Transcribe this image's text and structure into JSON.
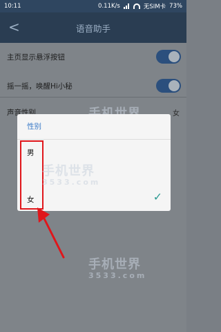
{
  "status_bar": {
    "time": "10:11",
    "speed": "0.11K/s",
    "sim_text": "无SIM卡",
    "battery": "73%"
  },
  "app_bar": {
    "back_label": "<",
    "title": "语音助手"
  },
  "settings": {
    "row1_label": "主页显示悬浮按钮",
    "row2_label": "摇一摇，唤醒Hi小秘",
    "row3_label": "声音性别",
    "row3_value": "女"
  },
  "dialog": {
    "title": "性别",
    "options": [
      {
        "label": "男",
        "selected": false
      },
      {
        "label": "女",
        "selected": true
      }
    ]
  },
  "watermark": {
    "text": "手机世界",
    "subtext": "3533.com"
  },
  "colors": {
    "accent": "#3a7ac8",
    "highlight": "#e0161b",
    "check": "#2e9b93"
  }
}
